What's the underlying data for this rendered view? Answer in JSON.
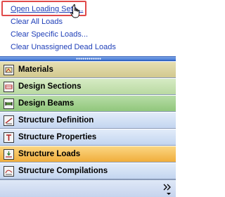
{
  "menu_links": [
    {
      "label": "Open Loading Sets..."
    },
    {
      "label": "Clear All Loads"
    },
    {
      "label": "Clear Specific Loads..."
    },
    {
      "label": "Clear Unassigned Dead Loads"
    }
  ],
  "panes": [
    {
      "label": "Materials",
      "icon": "materials-icon",
      "color": "#d8cf9a"
    },
    {
      "label": "Design Sections",
      "icon": "design-sections-icon",
      "color": "#c4deb0"
    },
    {
      "label": "Design Beams",
      "icon": "design-beams-icon",
      "color": "#9fcf8a"
    },
    {
      "label": "Structure Definition",
      "icon": "structure-definition-icon",
      "color": "#cfe0f4"
    },
    {
      "label": "Structure Properties",
      "icon": "structure-properties-icon",
      "color": "#cfe0f4"
    },
    {
      "label": "Structure Loads",
      "icon": "structure-loads-icon",
      "color": "#f6c15a",
      "selected": true
    },
    {
      "label": "Structure Compilations",
      "icon": "structure-compilations-icon",
      "color": "#cfe0f4"
    }
  ],
  "colors": {
    "link": "#1f3fb8",
    "highlight_box": "#e04a4a",
    "splitter": "#3b6fd0",
    "selected_pane": "#f6c15a"
  }
}
